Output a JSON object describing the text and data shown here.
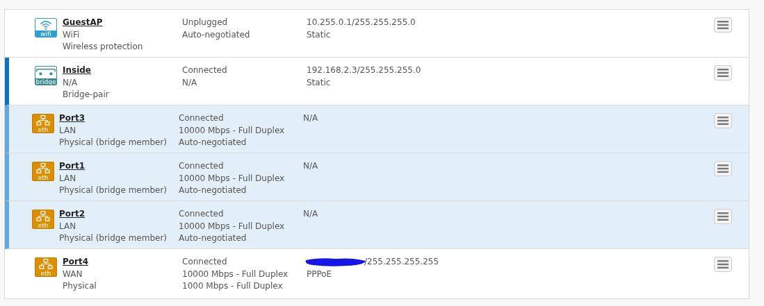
{
  "interfaces": [
    {
      "kind": "wireless",
      "expanded": false,
      "badge": "wifi",
      "name": "GuestAP",
      "details": [
        "WiFi",
        "Wireless protection"
      ],
      "status": [
        "Unplugged",
        "Auto-negotiated"
      ],
      "redacted": false,
      "address": [
        "10.255.0.1/255.255.255.0",
        "Static"
      ]
    },
    {
      "kind": "bridge",
      "expanded": true,
      "badge": "bridge",
      "name": "Inside",
      "details": [
        "N/A",
        "Bridge-pair"
      ],
      "status": [
        "Connected",
        "N/A"
      ],
      "redacted": false,
      "address": [
        "192.168.2.3/255.255.255.0",
        "Static"
      ]
    },
    {
      "kind": "bridge_member",
      "expanded": false,
      "badge": "eth",
      "name": "Port3",
      "details": [
        "LAN",
        "Physical (bridge member)"
      ],
      "status": [
        "Connected",
        "10000 Mbps - Full Duplex",
        "Auto-negotiated"
      ],
      "redacted": false,
      "address": [
        "N/A"
      ]
    },
    {
      "kind": "bridge_member",
      "expanded": false,
      "badge": "eth",
      "name": "Port1",
      "details": [
        "LAN",
        "Physical (bridge member)"
      ],
      "status": [
        "Connected",
        "10000 Mbps - Full Duplex",
        "Auto-negotiated"
      ],
      "redacted": false,
      "address": [
        "N/A"
      ]
    },
    {
      "kind": "bridge_member",
      "expanded": false,
      "badge": "eth",
      "name": "Port2",
      "details": [
        "LAN",
        "Physical (bridge member)"
      ],
      "status": [
        "Connected",
        "10000 Mbps - Full Duplex",
        "Auto-negotiated"
      ],
      "redacted": false,
      "address": [
        "N/A"
      ]
    },
    {
      "kind": "ethernet",
      "expanded": false,
      "badge": "eth",
      "name": "Port4",
      "details": [
        "WAN",
        "Physical"
      ],
      "status": [
        "Connected",
        "10000 Mbps - Full Duplex",
        "1000 Mbps - Full Duplex"
      ],
      "redacted": true,
      "address": [
        "/255.255.255.255",
        "PPPoE"
      ]
    }
  ]
}
